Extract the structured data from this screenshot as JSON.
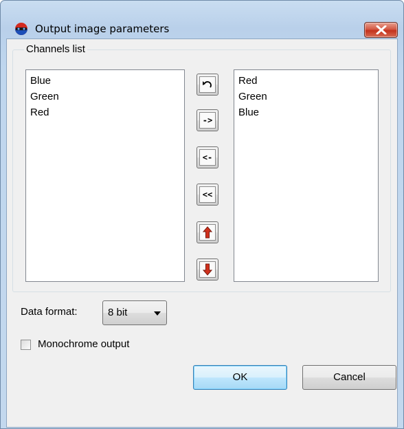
{
  "window": {
    "title": "Output image parameters",
    "close_icon": "close-icon"
  },
  "channels": {
    "group_label": "Channels list",
    "left_items": [
      "Blue",
      "Green",
      "Red"
    ],
    "right_items": [
      "Red",
      "Green",
      "Blue"
    ]
  },
  "tools": {
    "reset_icon": "undo-arrow-icon",
    "add_label": "->",
    "remove_label": "<-",
    "remove_all_label": "<<",
    "up_icon": "arrow-up-icon",
    "down_icon": "arrow-down-icon"
  },
  "format": {
    "label": "Data format:",
    "value": "8 bit"
  },
  "monochrome": {
    "label": "Monochrome output",
    "checked": false
  },
  "buttons": {
    "ok": "OK",
    "cancel": "Cancel"
  },
  "colors": {
    "arrow_red": "#d0301c",
    "accent_blue": "#3c7fb1"
  }
}
